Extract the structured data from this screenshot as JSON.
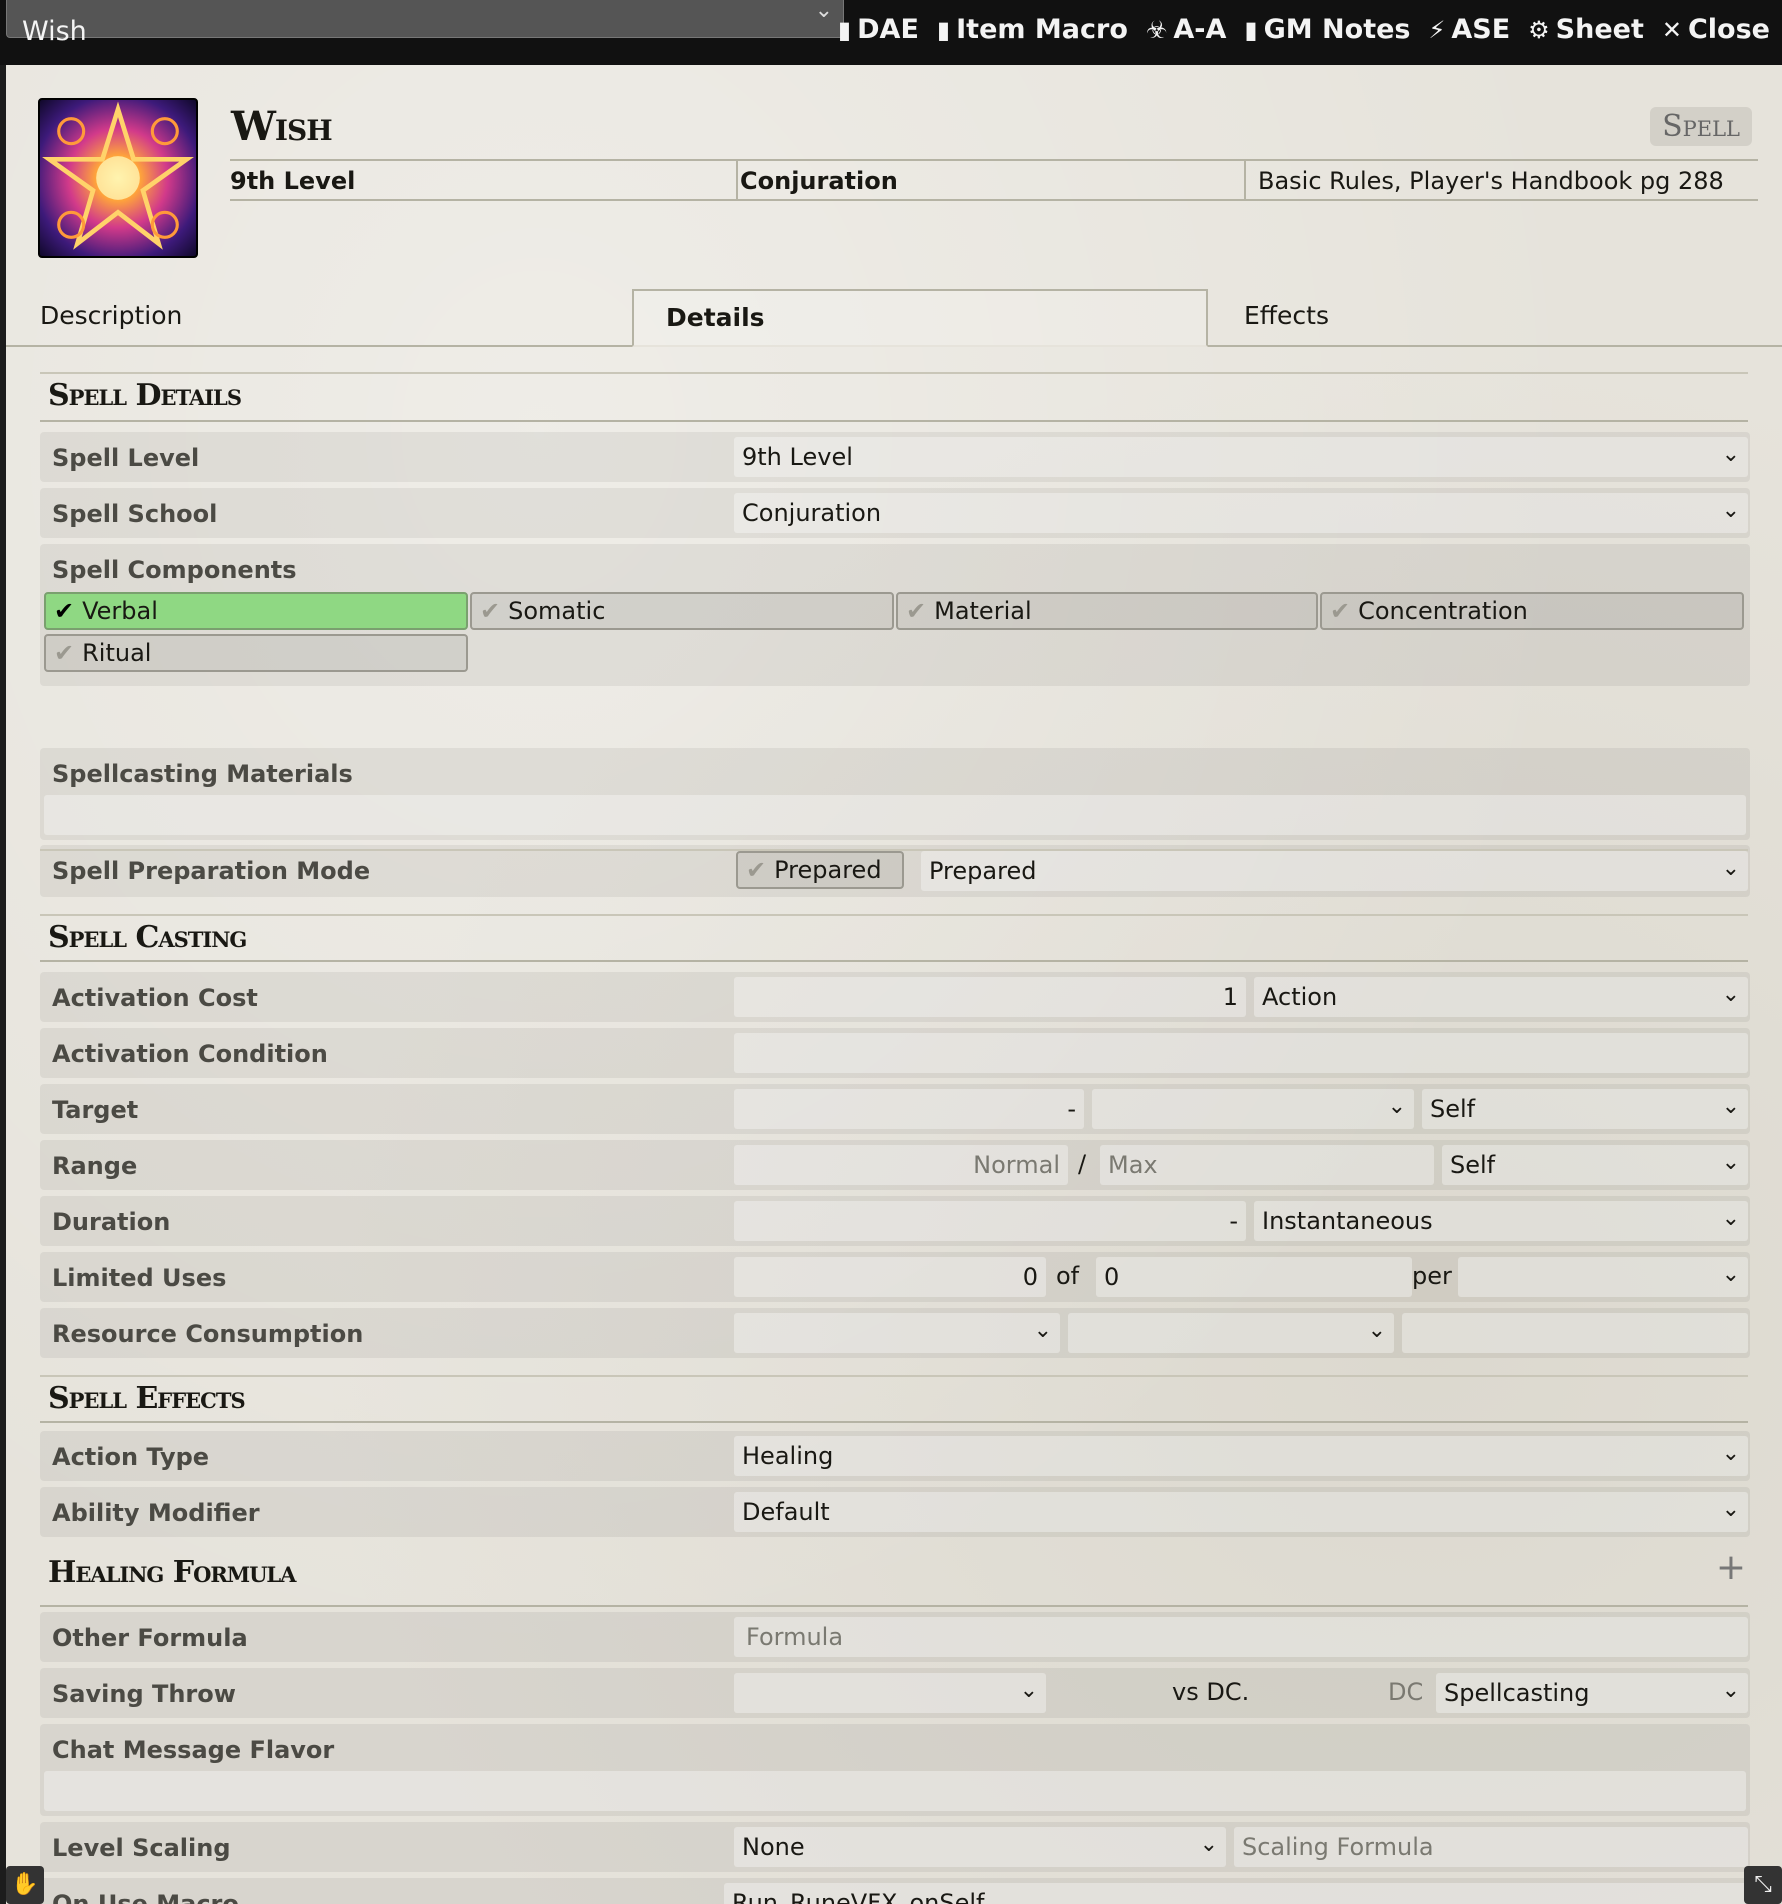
{
  "window": {
    "title": "Wish",
    "header_buttons": [
      {
        "label": "DAE",
        "icon": "clipboard-icon"
      },
      {
        "label": "Item Macro",
        "icon": "sticky-note-icon"
      },
      {
        "label": "A-A",
        "icon": "biohazard-icon"
      },
      {
        "label": "GM Notes",
        "icon": "clipboard-icon"
      },
      {
        "label": "ASE",
        "icon": "magic-wand-icon"
      },
      {
        "label": "Sheet",
        "icon": "gear-icon"
      },
      {
        "label": "Close",
        "icon": "close-icon"
      }
    ]
  },
  "item": {
    "name": "Wish",
    "type": "Spell",
    "level": "9th Level",
    "school": "Conjuration",
    "source": "Basic Rules, Player's Handbook pg 288"
  },
  "tabs": [
    "Description",
    "Details",
    "Effects"
  ],
  "active_tab": "Details",
  "sections": {
    "spell_details": "Spell Details",
    "spell_casting": "Spell Casting",
    "spell_effects": "Spell Effects",
    "healing_formula": "Healing Formula"
  },
  "details": {
    "spell_level": {
      "label": "Spell Level",
      "value": "9th Level"
    },
    "spell_school": {
      "label": "Spell School",
      "value": "Conjuration"
    },
    "components": {
      "label": "Spell Components",
      "items": [
        {
          "label": "Verbal",
          "checked": true
        },
        {
          "label": "Somatic",
          "checked": false
        },
        {
          "label": "Material",
          "checked": false
        },
        {
          "label": "Concentration",
          "checked": false
        },
        {
          "label": "Ritual",
          "checked": false
        }
      ]
    },
    "materials": {
      "label": "Spellcasting Materials",
      "value": ""
    },
    "prep_mode": {
      "label": "Spell Preparation Mode",
      "checkbox": "Prepared",
      "value": "Prepared"
    }
  },
  "casting": {
    "activation_cost": {
      "label": "Activation Cost",
      "value": "1",
      "unit": "Action"
    },
    "activation_condition": {
      "label": "Activation Condition",
      "value": ""
    },
    "target": {
      "label": "Target",
      "value": "-",
      "type": "",
      "unit": "Self"
    },
    "range": {
      "label": "Range",
      "normal": "Normal",
      "sep": "/",
      "max": "Max",
      "unit": "Self"
    },
    "duration": {
      "label": "Duration",
      "value": "-",
      "unit": "Instantaneous"
    },
    "limited_uses": {
      "label": "Limited Uses",
      "value": "0",
      "of": "of",
      "max": "0",
      "per": "per",
      "period": ""
    },
    "resource": {
      "label": "Resource Consumption"
    }
  },
  "effects": {
    "action_type": {
      "label": "Action Type",
      "value": "Healing"
    },
    "ability_modifier": {
      "label": "Ability Modifier",
      "value": "Default"
    },
    "other_formula": {
      "label": "Other Formula",
      "placeholder": "Formula"
    },
    "saving_throw": {
      "label": "Saving Throw",
      "vs": "vs DC.",
      "dc": "DC",
      "scaling": "Spellcasting"
    },
    "chat_flavor": {
      "label": "Chat Message Flavor",
      "value": ""
    },
    "level_scaling": {
      "label": "Level Scaling",
      "value": "None",
      "placeholder": "Scaling Formula"
    },
    "on_use_macro": {
      "label": "On Use Macro",
      "value": "Run_RuneVFX_onSelf"
    }
  }
}
